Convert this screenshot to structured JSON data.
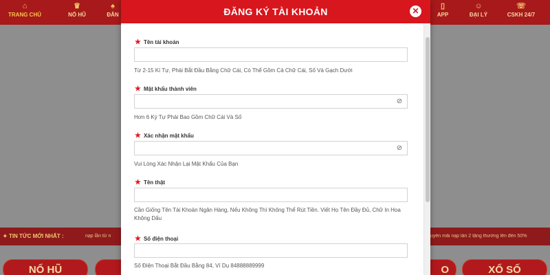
{
  "nav": {
    "items": [
      {
        "label": "TRANG CHỦ",
        "icon": "home-icon"
      },
      {
        "label": "NỔ HŨ",
        "icon": "slot-icon"
      },
      {
        "label": "ĐĂN",
        "icon": "cards-icon"
      },
      {
        "label": "APP",
        "icon": "phone-icon"
      },
      {
        "label": "ĐẠI LÝ",
        "icon": "agent-icon"
      },
      {
        "label": "CSKH 24/7",
        "icon": "support-icon"
      }
    ]
  },
  "ticker": {
    "label": "TIN TỨC MỚI NHẤT :",
    "text_left": "nạp lần từ n",
    "text_right": "uyến mãi nạp lần 2 tặng thưởng lên đến 50%"
  },
  "bottom_buttons": {
    "left": "NỔ HŨ",
    "right": "XỔ SỐ",
    "partial": "O"
  },
  "modal": {
    "title": "ĐĂNG KÝ TÀI KHOẢN",
    "close_icon": "close-icon",
    "fields": [
      {
        "label": "Tên tài khoản",
        "hint": "Từ 2-15 Kí Tự, Phải Bắt Đầu Bằng Chữ Cái, Có Thể Gồm Cả Chữ Cái, Số Và Gạch Dưới",
        "value": "",
        "has_eye": false
      },
      {
        "label": "Mật khẩu thành viên",
        "hint": "Hơn 6 Ký Tự Phải Bao Gồm Chữ Cái Và Số",
        "value": "",
        "has_eye": true
      },
      {
        "label": "Xác nhận mật khẩu",
        "hint": "Vui Lòng Xác Nhận Lại Mật Khẩu Của Bạn",
        "value": "",
        "has_eye": true
      },
      {
        "label": "Tên thật",
        "hint": "Cần Giống Tên Tài Khoản Ngân Hàng, Nếu Không Thì Không Thể Rút Tiền. Viết Họ Tên Đầy Đủ, Chữ In Hoa Không Dấu",
        "value": "",
        "has_eye": false
      },
      {
        "label": "Số điện thoại",
        "hint": "Số Điện Thoại Bắt Đầu Bằng 84, Ví Dụ 84888889999",
        "value": "",
        "has_eye": false
      }
    ]
  },
  "colors": {
    "header_red": "#d8161d",
    "nav_red": "#a8191b",
    "required_star": "#e0151b",
    "overlay_gray": "#8e8e8e"
  }
}
